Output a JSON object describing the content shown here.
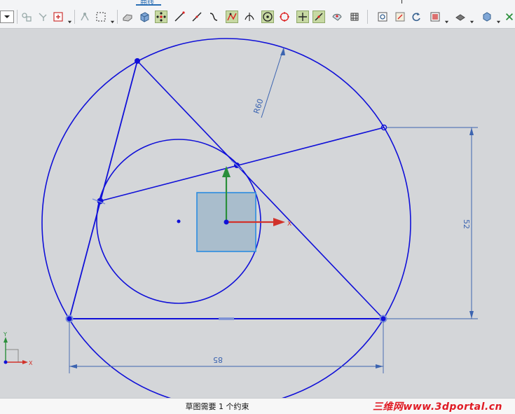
{
  "ribbon": {
    "active_tab": "曲线"
  },
  "toolbar": {
    "icons": [
      "dropdown-icon",
      "move-object-icon",
      "snap-icon",
      "pattern-icon",
      "transform-icon",
      "selection-box-icon",
      "shaded-block-icon",
      "block-icon",
      "vertex-points-icon",
      "line-icon",
      "line-icon-2",
      "curve-icon",
      "intersection-icon",
      "arc-tangent-icon",
      "circle-center-icon",
      "circle-point-icon",
      "cross-icon",
      "slash-line-icon",
      "edit-icon",
      "grid-icon",
      "view-fit-icon",
      "view-sketch-icon",
      "rotate-icon",
      "render-style-icon",
      "layer-icon",
      "cube-icon",
      "close-x-icon"
    ]
  },
  "sketch": {
    "dimensions": {
      "radius": "R60",
      "vertical": "52",
      "horizontal": "85"
    },
    "axes": {
      "x": "X",
      "y": "Y"
    }
  },
  "status": {
    "message": "草图需要 1 个约束",
    "watermark": "三维网www.3dportal.cn"
  },
  "colors": {
    "sketch_line": "#1010d8",
    "dimension": "#3c64b0",
    "x_axis": "#d1322a",
    "y_axis": "#2a8f3a",
    "plane_fill": "#a9bdcc",
    "plane_border": "#2b8ce0",
    "watermark": "#e01b24",
    "canvas_bg": "#d4d6d9"
  }
}
